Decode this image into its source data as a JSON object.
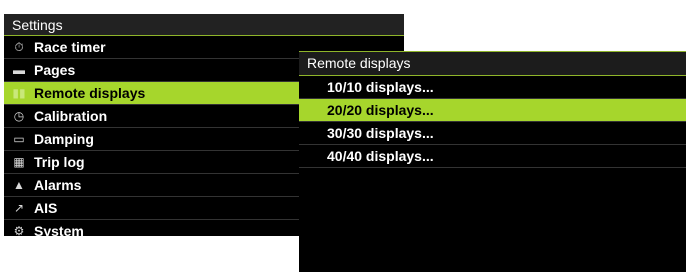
{
  "settings": {
    "title": "Settings",
    "items": [
      {
        "label": "Race timer",
        "icon": "stopwatch-icon",
        "glyph": "⏱"
      },
      {
        "label": "Pages",
        "icon": "pages-icon",
        "glyph": "▬"
      },
      {
        "label": "Remote displays",
        "icon": "remote-displays-icon",
        "glyph": "▮▮"
      },
      {
        "label": "Calibration",
        "icon": "calibration-icon",
        "glyph": "◷"
      },
      {
        "label": "Damping",
        "icon": "damping-icon",
        "glyph": "▭"
      },
      {
        "label": "Trip log",
        "icon": "trip-log-icon",
        "glyph": "▦"
      },
      {
        "label": "Alarms",
        "icon": "alarm-bell-icon",
        "glyph": "▲"
      },
      {
        "label": "AIS",
        "icon": "ais-icon",
        "glyph": "↗"
      },
      {
        "label": "System",
        "icon": "system-icon",
        "glyph": "⚙"
      }
    ],
    "selected_index": 2
  },
  "remote": {
    "title": "Remote displays",
    "items": [
      "10/10 displays...",
      "20/20 displays...",
      "30/30 displays...",
      "40/40 displays..."
    ],
    "selected_index": 1
  },
  "colors": {
    "accent": "#a6d62c",
    "background": "#000000"
  }
}
